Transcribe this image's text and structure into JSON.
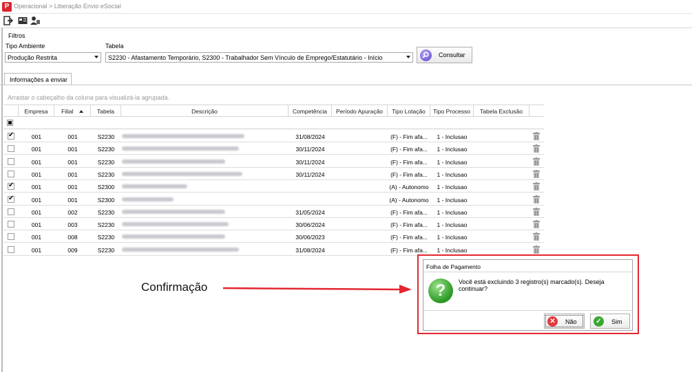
{
  "window": {
    "breadcrumb": "Operacional > Liberação Envio eSocial"
  },
  "toolbar": {
    "icons": [
      "exit-icon",
      "id-card-icon",
      "users-icon"
    ]
  },
  "filters": {
    "section_label": "Filtros",
    "tipo_ambiente_label": "Tipo Ambiente",
    "tipo_ambiente_value": "Produção Restrita",
    "tabela_label": "Tabela",
    "tabela_value": "S2230 - Afastamento Temporário, S2300 - Trabalhador Sem Vínculo de Emprego/Estatutário - Início",
    "consultar_label": "Consultar"
  },
  "tabs": [
    {
      "label": "Informações a enviar"
    }
  ],
  "grid": {
    "group_hint": "Arrastar o cabeçalho da coluna para visualizá-la agrupada.",
    "columns": {
      "empresa": "Empresa",
      "filial": "Filial",
      "tabela": "Tabela",
      "descricao": "Descrição",
      "competencia": "Competência",
      "periodo": "Período Apuração",
      "tipo_lotacao": "Tipo Lotação",
      "tipo_processo": "Tipo Processo",
      "tabela_exclusao": "Tabela Exclusão"
    },
    "rows": [
      {
        "checked": true,
        "empresa": "001",
        "filial": "001",
        "tabela": "S2230",
        "competencia": "31/08/2024",
        "periodo": "",
        "tipo_lotacao": "(F) - Fim afa...",
        "tipo_processo": "1 - Inclusao"
      },
      {
        "checked": false,
        "empresa": "001",
        "filial": "001",
        "tabela": "S2230",
        "competencia": "30/11/2024",
        "periodo": "",
        "tipo_lotacao": "(F) - Fim afa...",
        "tipo_processo": "1 - Inclusao"
      },
      {
        "checked": false,
        "empresa": "001",
        "filial": "001",
        "tabela": "S2230",
        "competencia": "30/11/2024",
        "periodo": "",
        "tipo_lotacao": "(F) - Fim afa...",
        "tipo_processo": "1 - Inclusao"
      },
      {
        "checked": false,
        "empresa": "001",
        "filial": "001",
        "tabela": "S2230",
        "competencia": "30/11/2024",
        "periodo": "",
        "tipo_lotacao": "(F) - Fim afa...",
        "tipo_processo": "1 - Inclusao"
      },
      {
        "checked": true,
        "empresa": "001",
        "filial": "001",
        "tabela": "S2300",
        "competencia": "",
        "periodo": "",
        "tipo_lotacao": "(A) - Autonomo",
        "tipo_processo": "1 - Inclusao"
      },
      {
        "checked": true,
        "empresa": "001",
        "filial": "001",
        "tabela": "S2300",
        "competencia": "",
        "periodo": "",
        "tipo_lotacao": "(A) - Autonomo",
        "tipo_processo": "1 - Inclusao"
      },
      {
        "checked": false,
        "empresa": "001",
        "filial": "002",
        "tabela": "S2230",
        "competencia": "31/05/2024",
        "periodo": "",
        "tipo_lotacao": "(F) - Fim afa...",
        "tipo_processo": "1 - Inclusao"
      },
      {
        "checked": false,
        "empresa": "001",
        "filial": "003",
        "tabela": "S2230",
        "competencia": "30/06/2024",
        "periodo": "",
        "tipo_lotacao": "(F) - Fim afa...",
        "tipo_processo": "1 - Inclusao"
      },
      {
        "checked": false,
        "empresa": "001",
        "filial": "008",
        "tabela": "S2230",
        "competencia": "30/06/2023",
        "periodo": "",
        "tipo_lotacao": "(F) - Fim afa...",
        "tipo_processo": "1 - Inclusao"
      },
      {
        "checked": false,
        "empresa": "001",
        "filial": "009",
        "tabela": "S2230",
        "competencia": "31/08/2024",
        "periodo": "",
        "tipo_lotacao": "(F) - Fim afa...",
        "tipo_processo": "1 - Inclusao"
      }
    ]
  },
  "annotation": {
    "text": "Confirmação"
  },
  "dialog": {
    "title": "Folha de Pagamento",
    "message": "Você está excluindo 3 registro(s) marcado(s). Deseja continuar?",
    "no_label": "Não",
    "yes_label": "Sim"
  },
  "colors": {
    "annotation_red": "#e3262f",
    "brand_red": "#d8262c",
    "question_green": "#2e9d2a"
  }
}
